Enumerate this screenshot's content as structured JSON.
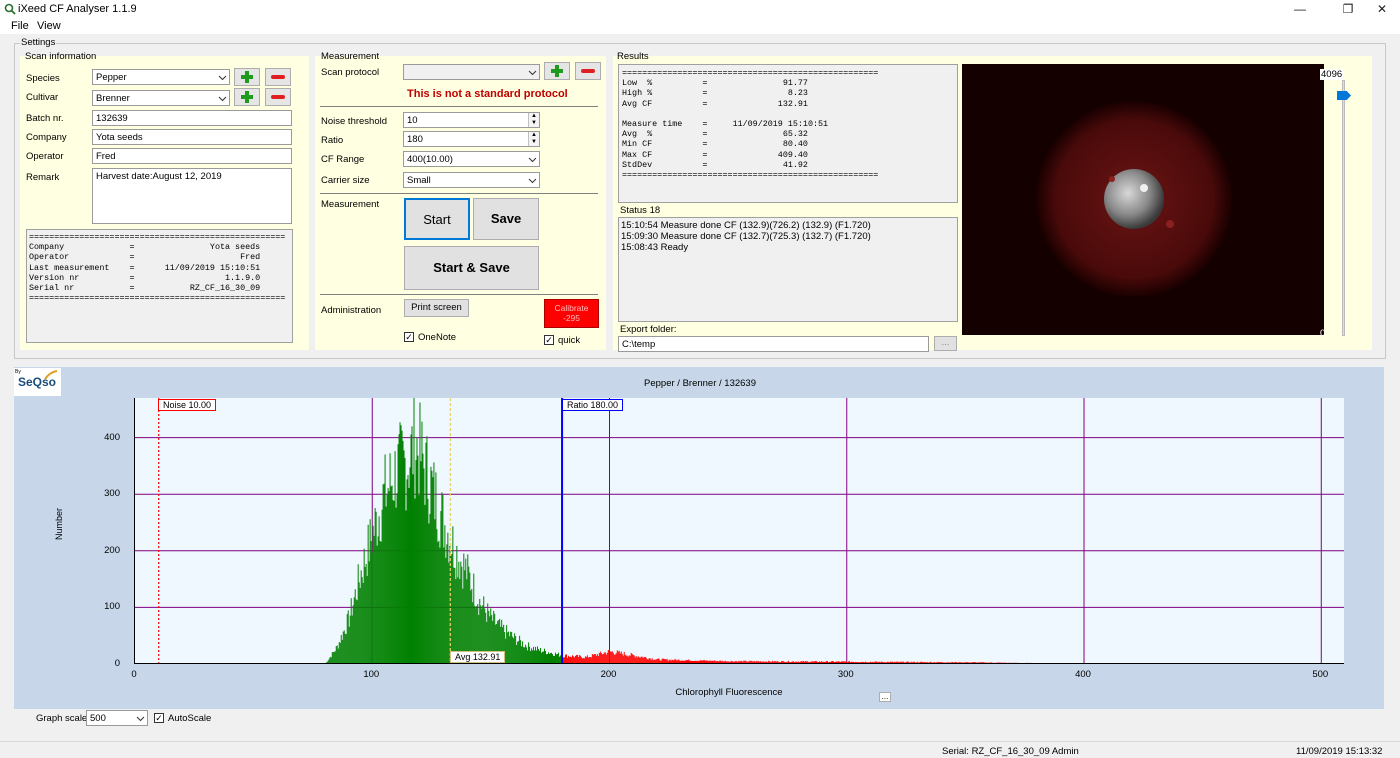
{
  "window": {
    "title": "iXeed CF Analyser 1.1.9"
  },
  "menu": [
    "File",
    "View"
  ],
  "settings": {
    "label": "Settings",
    "scan_info": {
      "label": "Scan information",
      "species": {
        "label": "Species",
        "value": "Pepper"
      },
      "cultivar": {
        "label": "Cultivar",
        "value": "Brenner"
      },
      "batch": {
        "label": "Batch nr.",
        "value": "132639"
      },
      "company": {
        "label": "Company",
        "value": "Yota seeds"
      },
      "operator": {
        "label": "Operator",
        "value": "Fred"
      },
      "remark": {
        "label": "Remark",
        "value": "Harvest date:August 12, 2019"
      },
      "info_text": "===================================================\nCompany             =               Yota seeds\nOperator            =                     Fred\nLast measurement    =      11/09/2019 15:10:51\nVersion nr          =                  1.1.9.0\nSerial nr           =           RZ_CF_16_30_09\n==================================================="
    },
    "measurement": {
      "label": "Measurement",
      "scan_protocol": {
        "label": "Scan protocol",
        "value": ""
      },
      "warning": "This is not a standard protocol",
      "noise": {
        "label": "Noise threshold",
        "value": "10"
      },
      "ratio": {
        "label": "Ratio",
        "value": "180"
      },
      "cf_range": {
        "label": "CF Range",
        "value": "400(10.00)"
      },
      "carrier": {
        "label": "Carrier size",
        "value": "Small"
      },
      "measure_label": "Measurement",
      "start": "Start",
      "save": "Save",
      "start_save": "Start & Save",
      "admin_label": "Administration",
      "print": "Print screen",
      "calibrate": "Calibrate\n-295",
      "onenote": "OneNote",
      "quick": "quick"
    },
    "results": {
      "label": "Results",
      "text": "===================================================\nLow  %          =               91.77\nHigh %          =                8.23\nAvg CF          =              132.91\n\nMeasure time    =     11/09/2019 15:10:51\nAvg  %          =               65.32\nMin CF          =               80.40\nMax CF          =              409.40\nStdDev          =               41.92\n===================================================",
      "status_label": "Status 18",
      "status_lines": [
        "15:10:54 Measure done CF (132.9)(726.2)  (132.9) (F1.720)",
        "15:09:30 Measure done CF (132.7)(725.3)  (132.7) (F1.720)",
        "15:08:43 Ready"
      ],
      "export_label": "Export folder:",
      "export_value": "C:\\temp",
      "browse": "...",
      "slider_max": "4096",
      "slider_min": "0",
      "slider_value": 4096
    }
  },
  "graph": {
    "logo_by": "By",
    "logo": "SeQso",
    "title": "Pepper / Brenner / 132639",
    "noise_label": "Noise 10.00",
    "ratio_label": "Ratio 180.00",
    "avg_label": "Avg 132.91",
    "more": "...",
    "scale_label": "Graph scale",
    "scale_value": "500",
    "autoscale": "AutoScale",
    "colors": {
      "below": "#008000",
      "above": "#ff0000",
      "grid": "#800080",
      "bg": "#f0f8ff"
    }
  },
  "chart_data": {
    "type": "bar",
    "title": "Pepper / Brenner / 132639",
    "xlabel": "Chlorophyll Fluorescence",
    "ylabel": "Number",
    "xlim": [
      0,
      510
    ],
    "ylim": [
      0,
      470
    ],
    "x_ticks": [
      0,
      100,
      200,
      300,
      400,
      500
    ],
    "y_ticks": [
      0,
      100,
      200,
      300,
      400
    ],
    "noise": 10,
    "ratio": 180,
    "avg": 132.91,
    "series": [
      {
        "values_x": [
          80,
          85,
          90,
          95,
          100,
          105,
          110,
          115,
          118,
          120,
          125,
          130,
          135,
          140,
          145,
          150,
          155,
          160,
          165,
          170,
          175,
          180,
          190,
          200,
          220,
          250,
          300,
          350,
          409
        ],
        "values_y": [
          0,
          30,
          80,
          160,
          230,
          300,
          340,
          360,
          390,
          370,
          310,
          250,
          200,
          160,
          110,
          80,
          60,
          45,
          32,
          25,
          20,
          15,
          12,
          22,
          8,
          5,
          4,
          3,
          0
        ]
      }
    ]
  },
  "status_bar": {
    "serial": "Serial: RZ_CF_16_30_09  Admin",
    "datetime": "11/09/2019 15:13:32"
  }
}
